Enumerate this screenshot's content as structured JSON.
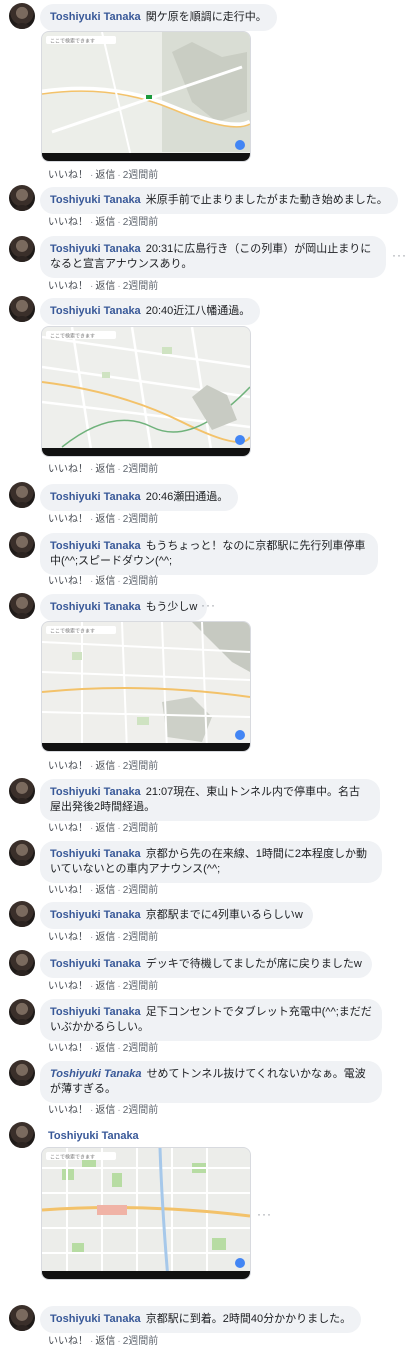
{
  "action_labels": {
    "like": "いいね！",
    "reply": "返信",
    "time": "2週間前"
  },
  "comments": [
    {
      "name": "Toshiyuki Tanaka",
      "text": "関ケ原を順調に走行中。"
    },
    {
      "name": "Toshiyuki Tanaka",
      "text": "米原手前で止まりましたがまた動き始めました。"
    },
    {
      "name": "Toshiyuki Tanaka",
      "text": "20:31に広島行き（この列車）が岡山止まりになると宣言アナウンスあり。"
    },
    {
      "name": "Toshiyuki Tanaka",
      "text": "20:40近江八幡通過。"
    },
    {
      "name": "Toshiyuki Tanaka",
      "text": "20:46瀬田通過。"
    },
    {
      "name": "Toshiyuki Tanaka",
      "text": "もうちょっと！なのに京都駅に先行列車停車中(^^;スピードダウン(^^;"
    },
    {
      "name": "Toshiyuki Tanaka",
      "text": "もう少しw"
    },
    {
      "name": "Toshiyuki Tanaka",
      "text": "21:07現在、東山トンネル内で停車中。名古屋出発後2時間経過。"
    },
    {
      "name": "Toshiyuki Tanaka",
      "text": "京都から先の在来線、1時間に2本程度しか動いていないとの車内アナウンス(^^;"
    },
    {
      "name": "Toshiyuki Tanaka",
      "text": "京都駅までに4列車いるらしいw"
    },
    {
      "name": "Toshiyuki Tanaka",
      "text": "デッキで待機してましたが席に戻りましたw"
    },
    {
      "name": "Toshiyuki Tanaka",
      "text": "足下コンセントでタブレット充電中(^^;まだだいぶかかるらしい。"
    },
    {
      "name": "Toshiyuki Tanaka",
      "text": "せめてトンネル抜けてくれないかなぁ。電波が薄すぎる。"
    },
    {
      "name": "Toshiyuki Tanaka",
      "text": ""
    },
    {
      "name": "Toshiyuki Tanaka",
      "text": "京都駅に到着。2時間40分かかりました。"
    }
  ],
  "map_search_placeholder": "ここで検索できます",
  "more_glyph": "···"
}
